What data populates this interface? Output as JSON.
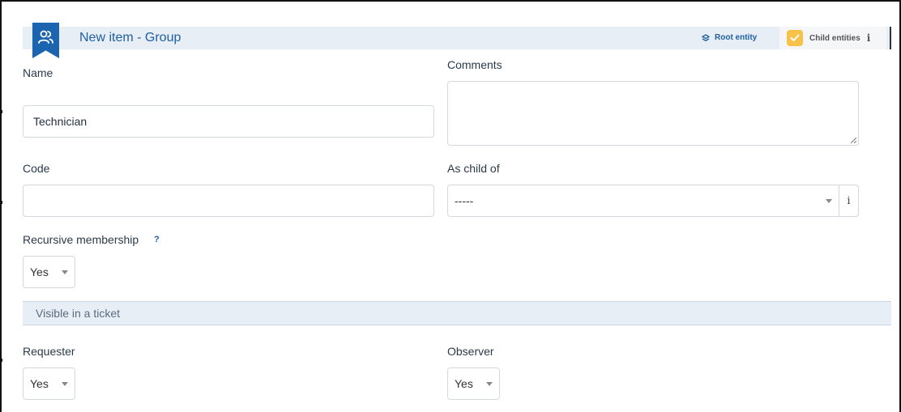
{
  "header": {
    "title": "New item - Group",
    "root_entity_label": "Root entity",
    "child_entities_label": "Child entities"
  },
  "form": {
    "name": {
      "label": "Name",
      "value": "Technician"
    },
    "comments": {
      "label": "Comments",
      "value": ""
    },
    "code": {
      "label": "Code",
      "value": ""
    },
    "as_child_of": {
      "label": "As child of",
      "value": "-----"
    },
    "recursive_membership": {
      "label": "Recursive membership",
      "help": "?",
      "value": "Yes"
    }
  },
  "section": {
    "title": "Visible in a ticket"
  },
  "ticket": {
    "requester": {
      "label": "Requester",
      "value": "Yes"
    },
    "observer": {
      "label": "Observer",
      "value": "Yes"
    }
  },
  "icons": {
    "badge": "users-icon",
    "root": "layers-icon",
    "child": "checkbox-checked-icon",
    "info": "info-icon"
  },
  "colors": {
    "accent": "#205fa1",
    "badge": "#1d64b0",
    "checkbox": "#f8c24a",
    "header_bg": "#e7eef6"
  }
}
